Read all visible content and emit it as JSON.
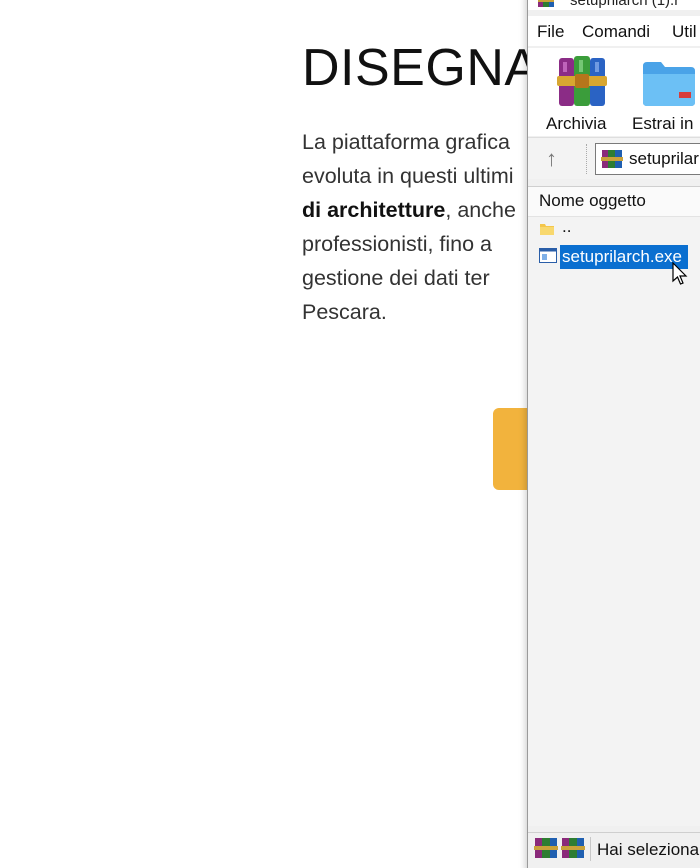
{
  "page": {
    "heading": "DISEGNA",
    "paragraph_lines": [
      "La piattaforma grafica",
      "evoluta in questi ultimi",
      "di architetture",
      ", anche",
      "professionisti, fino a",
      "gestione dei dati ter",
      "Pescara."
    ],
    "cta_color": "#f2b33d"
  },
  "winrar": {
    "title": "setuprilarch (1).r",
    "menu": [
      "File",
      "Comandi",
      "Util"
    ],
    "toolbar": [
      {
        "label": "Archivia",
        "icon": "winrar-books-icon"
      },
      {
        "label": "Estrai in",
        "icon": "extract-folder-icon"
      }
    ],
    "address": "setuprilar",
    "column_header": "Nome oggetto",
    "parent_row": "..",
    "selected_file": "setuprilarch.exe",
    "status_text": "Hai seleziona",
    "selection_color": "#0a6fd0"
  }
}
